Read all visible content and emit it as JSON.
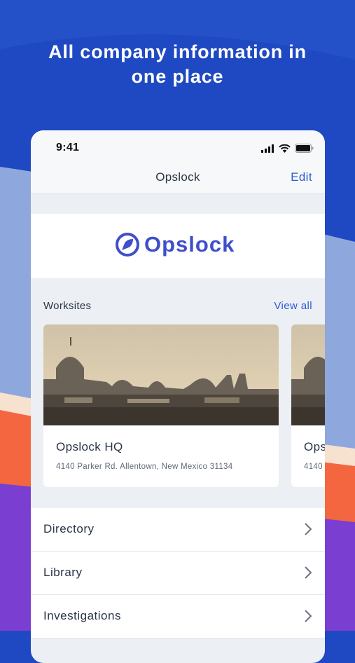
{
  "headline": {
    "line1": "All company information in",
    "line2": "one place"
  },
  "status_bar": {
    "time": "9:41",
    "icons": [
      "signal-icon",
      "wifi-icon",
      "battery-icon"
    ]
  },
  "navbar": {
    "title": "Opslock",
    "edit_label": "Edit"
  },
  "logo": {
    "text": "Opslock",
    "icon": "opslock-logo-icon",
    "color": "#3f4ec9"
  },
  "worksites": {
    "title": "Worksites",
    "view_all_label": "View all",
    "items": [
      {
        "name": "Opslock HQ",
        "address": "4140 Parker Rd. Allentown, New Mexico 31134"
      },
      {
        "name": "Ops",
        "address": "4140"
      }
    ]
  },
  "menu": {
    "items": [
      {
        "label": "Directory",
        "icon": "chevron-right-icon"
      },
      {
        "label": "Library",
        "icon": "chevron-right-icon"
      },
      {
        "label": "Investigations",
        "icon": "chevron-right-icon"
      }
    ]
  },
  "colors": {
    "background_blue": "#1e49c2",
    "accent_blue": "#2d5bd1",
    "orange": "#f4663f",
    "purple": "#7a3fd0",
    "light_blue": "#8ea7dd"
  }
}
